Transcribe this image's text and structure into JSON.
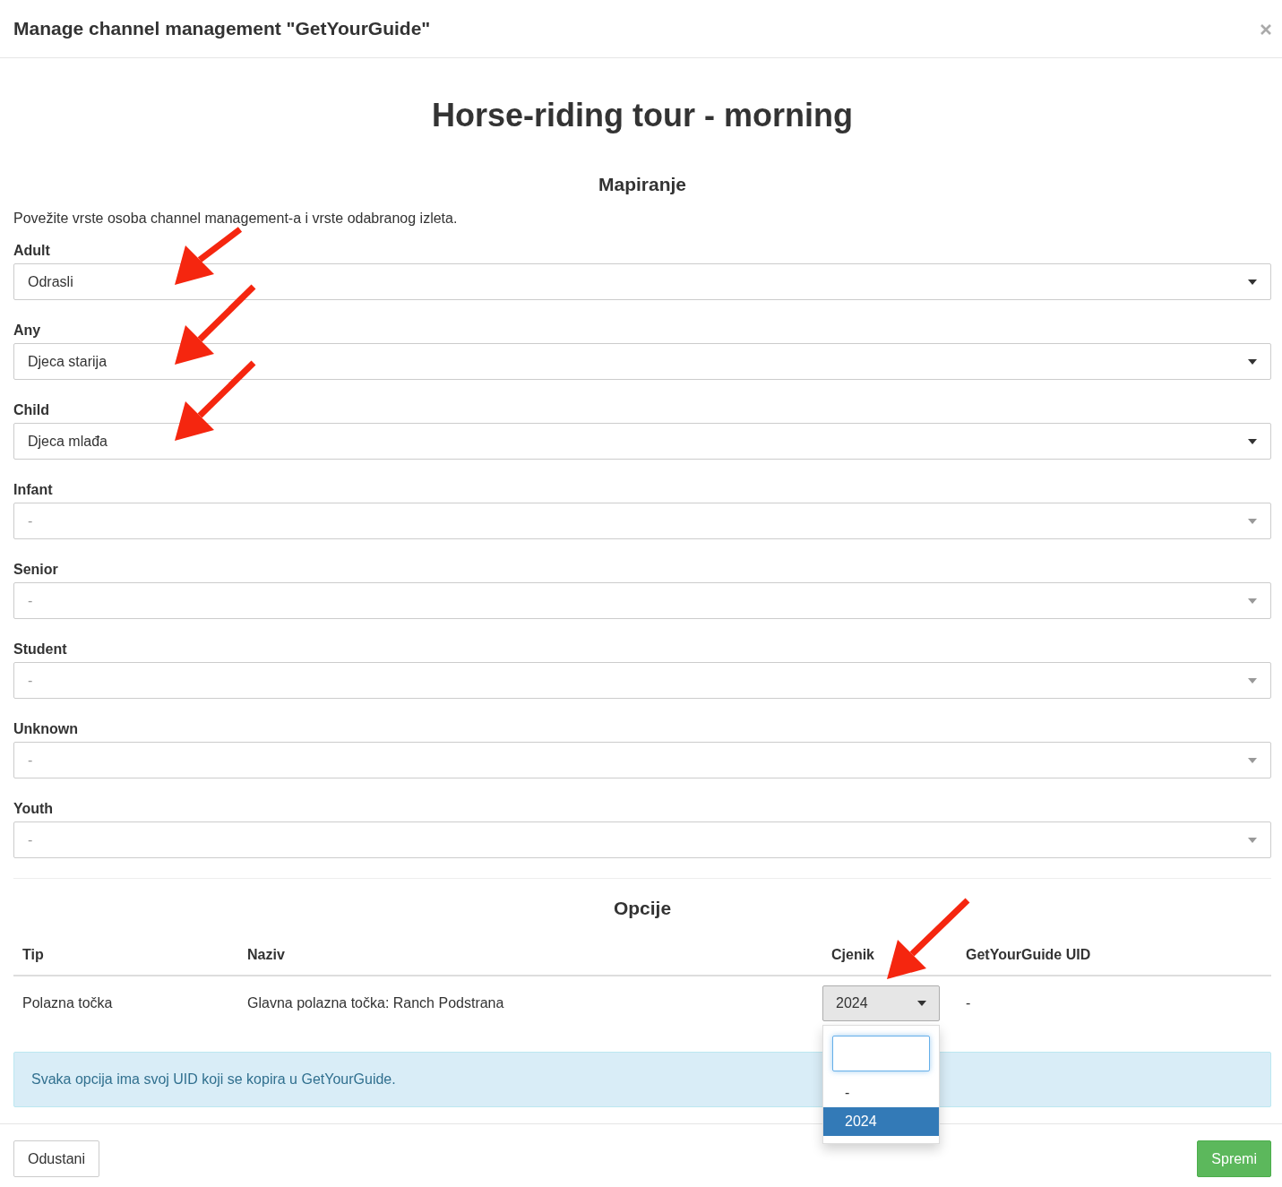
{
  "modal": {
    "title": "Manage channel management \"GetYourGuide\""
  },
  "heading": "Horse-riding tour - morning",
  "mapping": {
    "title": "Mapiranje",
    "intro": "Povežite vrste osoba channel management-a i vrste odabranog izleta.",
    "fields": [
      {
        "label": "Adult",
        "value": "Odrasli"
      },
      {
        "label": "Any",
        "value": "Djeca starija"
      },
      {
        "label": "Child",
        "value": "Djeca mlađa"
      },
      {
        "label": "Infant",
        "placeholder": "-"
      },
      {
        "label": "Senior",
        "placeholder": "-"
      },
      {
        "label": "Student",
        "placeholder": "-"
      },
      {
        "label": "Unknown",
        "placeholder": "-"
      },
      {
        "label": "Youth",
        "placeholder": "-"
      }
    ]
  },
  "options": {
    "title": "Opcije",
    "columns": [
      "Tip",
      "Naziv",
      "Cjenik",
      "GetYourGuide UID"
    ],
    "rows": [
      {
        "type": "Polazna točka",
        "name": "Glavna polazna točka: Ranch Podstrana",
        "pricelist": "2024",
        "uid": "-",
        "dropdown_open": true,
        "dropdown_options": [
          {
            "label": "-",
            "selected": false
          },
          {
            "label": "2024",
            "selected": true
          }
        ]
      }
    ]
  },
  "alert": "Svaka opcija ima svoj UID koji se kopira u GetYourGuide.",
  "buttons": {
    "cancel": "Odustani",
    "save": "Spremi"
  }
}
